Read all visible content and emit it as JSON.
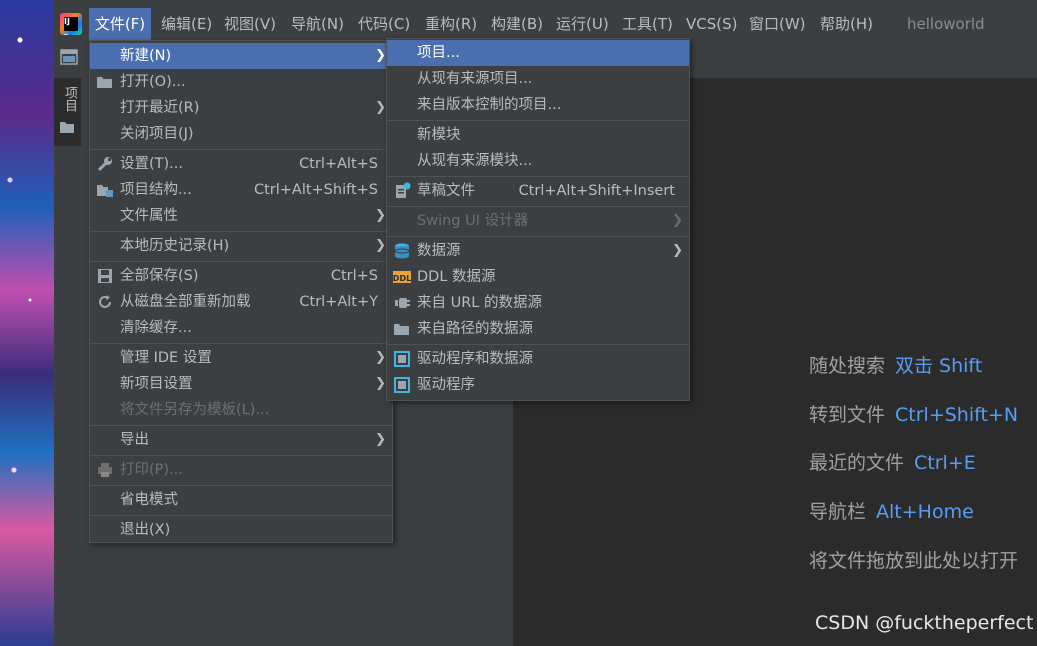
{
  "menubar": {
    "items": [
      "文件(F)",
      "编辑(E)",
      "视图(V)",
      "导航(N)",
      "代码(C)",
      "重构(R)",
      "构建(B)",
      "运行(U)",
      "工具(T)",
      "VCS(S)",
      "窗口(W)",
      "帮助(H)"
    ],
    "project_name": "helloworld"
  },
  "sidebar": {
    "project_tab": "项目"
  },
  "file_menu": {
    "items": [
      {
        "label": "新建(N)",
        "shortcut": "",
        "submenu": true
      },
      {
        "label": "打开(O)...",
        "shortcut": ""
      },
      {
        "label": "打开最近(R)",
        "shortcut": "",
        "submenu": true
      },
      {
        "label": "关闭项目(J)",
        "shortcut": ""
      },
      {
        "label": "设置(T)...",
        "shortcut": "Ctrl+Alt+S"
      },
      {
        "label": "项目结构...",
        "shortcut": "Ctrl+Alt+Shift+S"
      },
      {
        "label": "文件属性",
        "shortcut": "",
        "submenu": true
      },
      {
        "label": "本地历史记录(H)",
        "shortcut": "",
        "submenu": true
      },
      {
        "label": "全部保存(S)",
        "shortcut": "Ctrl+S"
      },
      {
        "label": "从磁盘全部重新加载",
        "shortcut": "Ctrl+Alt+Y"
      },
      {
        "label": "清除缓存...",
        "shortcut": ""
      },
      {
        "label": "管理 IDE 设置",
        "shortcut": "",
        "submenu": true
      },
      {
        "label": "新项目设置",
        "shortcut": "",
        "submenu": true
      },
      {
        "label": "将文件另存为模板(L)...",
        "shortcut": "",
        "disabled": true
      },
      {
        "label": "导出",
        "shortcut": "",
        "submenu": true
      },
      {
        "label": "打印(P)...",
        "shortcut": "",
        "disabled": true
      },
      {
        "label": "省电模式",
        "shortcut": ""
      },
      {
        "label": "退出(X)",
        "shortcut": ""
      }
    ]
  },
  "new_menu": {
    "items": [
      {
        "label": "项目...",
        "shortcut": ""
      },
      {
        "label": "从现有来源项目...",
        "shortcut": ""
      },
      {
        "label": "来自版本控制的项目...",
        "shortcut": ""
      },
      {
        "label": "新模块",
        "shortcut": ""
      },
      {
        "label": "从现有来源模块...",
        "shortcut": ""
      },
      {
        "label": "草稿文件",
        "shortcut": "Ctrl+Alt+Shift+Insert"
      },
      {
        "label": "Swing UI 设计器",
        "shortcut": "",
        "disabled": true
      },
      {
        "label": "数据源",
        "shortcut": ""
      },
      {
        "label": "DDL 数据源",
        "shortcut": ""
      },
      {
        "label": "来自 URL 的数据源",
        "shortcut": ""
      },
      {
        "label": "来自路径的数据源",
        "shortcut": ""
      },
      {
        "label": "驱动程序和数据源",
        "shortcut": ""
      },
      {
        "label": "驱动程序",
        "shortcut": ""
      }
    ]
  },
  "editor_hints": [
    {
      "text": "随处搜索",
      "key": "双击 Shift"
    },
    {
      "text": "转到文件",
      "key": "Ctrl+Shift+N"
    },
    {
      "text": "最近的文件",
      "key": "Ctrl+E"
    },
    {
      "text": "导航栏",
      "key": "Alt+Home"
    },
    {
      "text": "将文件拖放到此处以打开",
      "key": ""
    }
  ],
  "watermark": "CSDN @fucktheperfect",
  "colors": {
    "accent": "#4b6eaf",
    "link": "#589df6",
    "menu_bg": "#3c3f41",
    "editor_bg": "#2b2b2b"
  }
}
